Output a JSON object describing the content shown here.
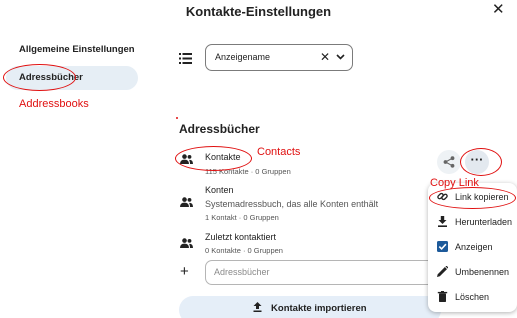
{
  "dialog": {
    "title": "Kontakte-Einstellungen"
  },
  "nav": {
    "general": "Allgemeine Einstellungen",
    "addressbooks": "Adressbücher"
  },
  "sort_select": {
    "value": "Anzeigename"
  },
  "section": {
    "title": "Adressbücher"
  },
  "books": [
    {
      "name": "Kontakte",
      "meta": "115 Kontakte · 0 Gruppen"
    },
    {
      "name": "Konten",
      "description": "Systemadressbuch, das alle Konten enthält",
      "meta": "1 Kontakt · 0 Gruppen"
    },
    {
      "name": "Zuletzt kontaktiert",
      "meta": "0 Kontakte · 0 Gruppen"
    }
  ],
  "new_addressbook": {
    "placeholder": "Adressbücher"
  },
  "import_button": "Kontakte importieren",
  "menu": {
    "items": [
      {
        "label": "Link kopieren",
        "icon": "link-icon"
      },
      {
        "label": "Herunterladen",
        "icon": "download-icon"
      },
      {
        "label": "Anzeigen",
        "icon": "checkbox-checked-icon"
      },
      {
        "label": "Umbenennen",
        "icon": "pencil-icon"
      },
      {
        "label": "Löschen",
        "icon": "trash-icon"
      }
    ]
  },
  "annotations": {
    "addressbooks": "Addressbooks",
    "contacts": "Contacts",
    "copy_link": "Copy Link"
  },
  "colors": {
    "annotation": "#e01010",
    "accent": "#1d5a9a",
    "active_nav": "#e6eef5"
  }
}
